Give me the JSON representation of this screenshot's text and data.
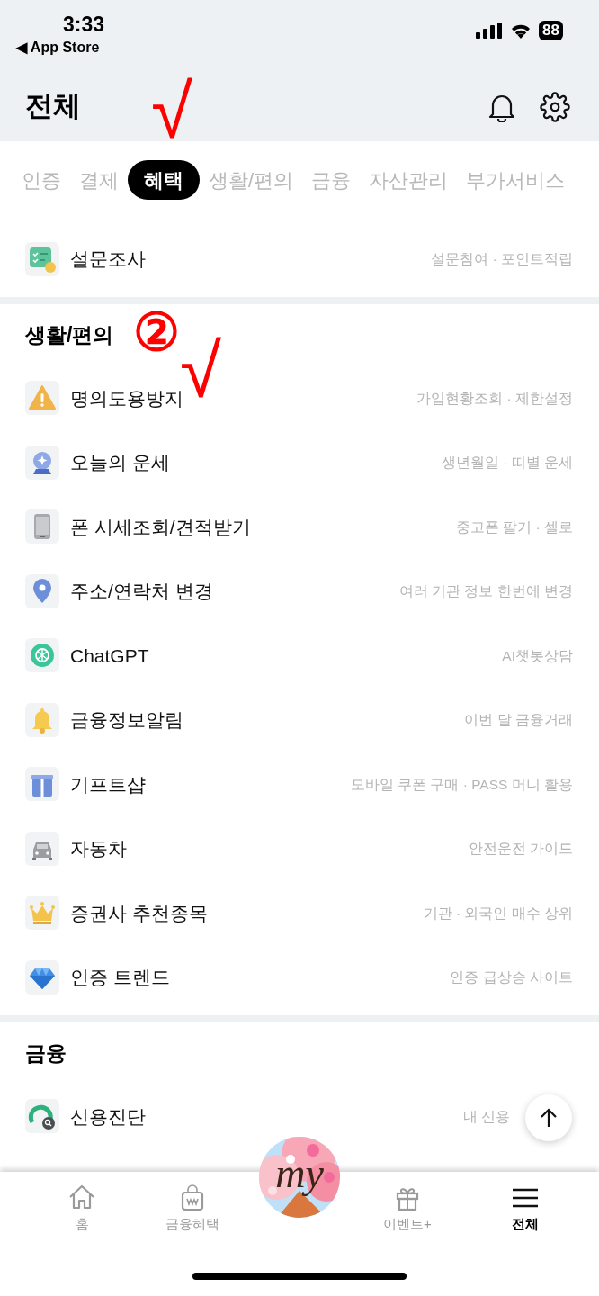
{
  "status_bar": {
    "time": "3:33",
    "back_link": "◀ App Store",
    "battery": "88"
  },
  "header": {
    "title": "전체"
  },
  "tabs": [
    {
      "label": "인증",
      "selected": false
    },
    {
      "label": "결제",
      "selected": false
    },
    {
      "label": "혜택",
      "selected": true
    },
    {
      "label": "생활/편의",
      "selected": false
    },
    {
      "label": "금융",
      "selected": false
    },
    {
      "label": "자산관리",
      "selected": false
    },
    {
      "label": "부가서비스",
      "selected": false
    }
  ],
  "sections": [
    {
      "items": [
        {
          "title": "설문조사",
          "subtitle": "설문참여 · 포인트적립"
        }
      ]
    },
    {
      "heading": "생활/편의",
      "items": [
        {
          "title": "명의도용방지",
          "subtitle": "가입현황조회 · 제한설정"
        },
        {
          "title": "오늘의 운세",
          "subtitle": "생년월일 · 띠별 운세"
        },
        {
          "title": "폰 시세조회/견적받기",
          "subtitle": "중고폰 팔기 · 셀로"
        },
        {
          "title": "주소/연락처 변경",
          "subtitle": "여러 기관 정보 한번에 변경"
        },
        {
          "title": "ChatGPT",
          "subtitle": "AI챗봇상담"
        },
        {
          "title": "금융정보알림",
          "subtitle": "이번 달 금융거래"
        },
        {
          "title": "기프트샵",
          "subtitle": "모바일 쿠폰 구매 · PASS 머니 활용"
        },
        {
          "title": "자동차",
          "subtitle": "안전운전 가이드"
        },
        {
          "title": "증권사 추천종목",
          "subtitle": "기관 · 외국인 매수 상위"
        },
        {
          "title": "인증 트렌드",
          "subtitle": "인증 급상승 사이트"
        }
      ]
    },
    {
      "heading": "금융",
      "items": [
        {
          "title": "신용진단",
          "subtitle": "내 신용"
        }
      ]
    }
  ],
  "bottom_nav": {
    "center_label": "my",
    "items": [
      {
        "label": "홈",
        "selected": false
      },
      {
        "label": "금융혜택",
        "selected": false
      },
      {
        "label": "이벤트+",
        "selected": false
      },
      {
        "label": "전체",
        "selected": true
      }
    ]
  },
  "annotations": [
    {
      "text": "√"
    },
    {
      "text": "②"
    },
    {
      "text": "√"
    }
  ]
}
